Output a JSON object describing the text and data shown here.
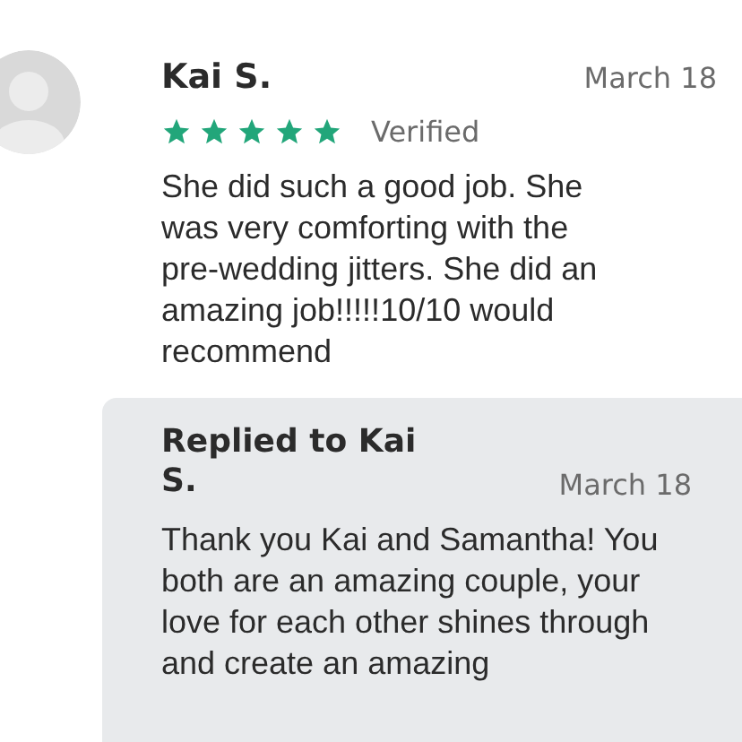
{
  "review": {
    "author": "Kai S.",
    "date": "March 18",
    "stars": 5,
    "verified": "Verified",
    "text": "She did such a good job. She was very comforting with the pre-wedding jitters. She did an amazing job!!!!!10/10 would recommend"
  },
  "reply": {
    "title": "Replied to Kai S.",
    "date": "March 18",
    "text": "Thank you Kai and Samantha! You both are an amazing couple, your love for each other shines through and create an amazing"
  }
}
